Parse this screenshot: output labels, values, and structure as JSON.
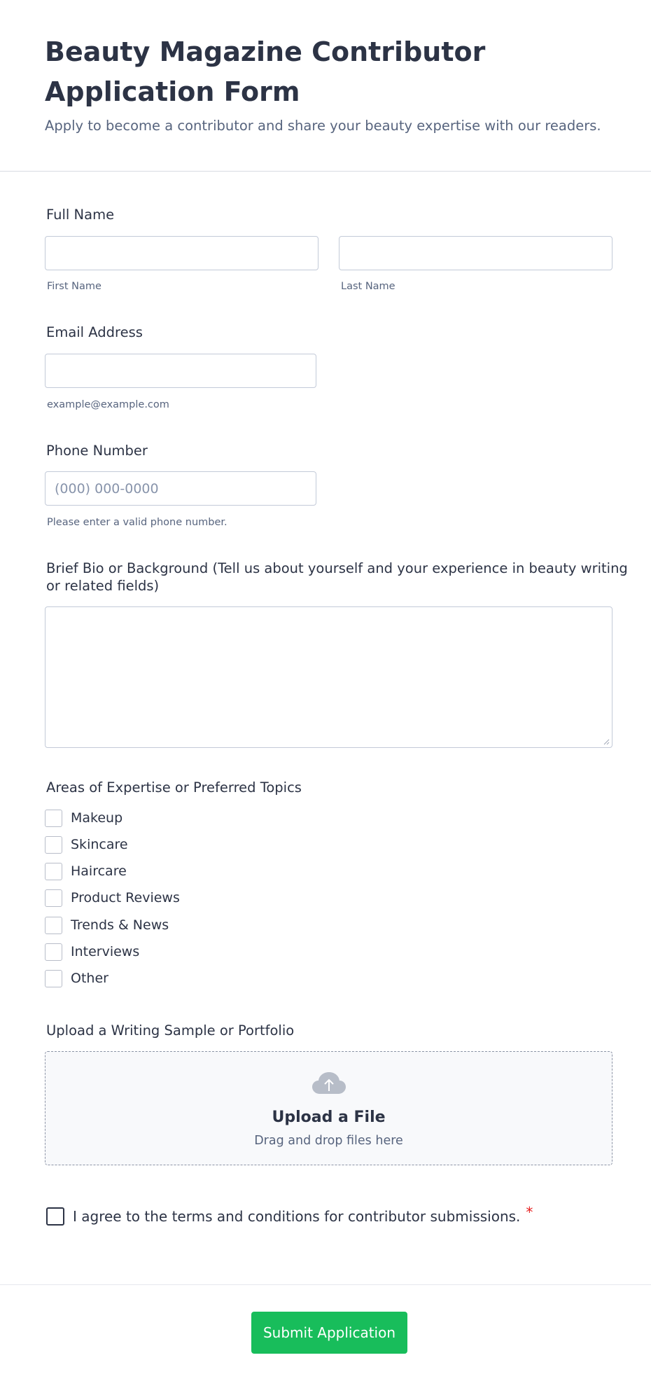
{
  "header": {
    "title": "Beauty Magazine Contributor Application Form",
    "subtitle": "Apply to become a contributor and share your beauty expertise with our readers."
  },
  "full_name": {
    "label": "Full Name",
    "first_sublabel": "First Name",
    "last_sublabel": "Last Name",
    "first_value": "",
    "last_value": ""
  },
  "email": {
    "label": "Email Address",
    "value": "",
    "sublabel": "example@example.com"
  },
  "phone": {
    "label": "Phone Number",
    "placeholder": "(000) 000-0000",
    "sublabel": "Please enter a valid phone number."
  },
  "bio": {
    "label_line1": "Brief Bio or Background (Tell us about yourself and your experience in beauty writing",
    "label_line2": "or related fields)",
    "value": ""
  },
  "expertise": {
    "label": "Areas of Expertise or Preferred Topics",
    "options": [
      "Makeup",
      "Skincare",
      "Haircare",
      "Product Reviews",
      "Trends & News",
      "Interviews",
      "Other"
    ]
  },
  "upload": {
    "label": "Upload a Writing Sample or Portfolio",
    "title": "Upload a File",
    "subtitle": "Drag and drop files here"
  },
  "terms": {
    "label": "I agree to the terms and conditions for contributor submissions.",
    "required_mark": "*"
  },
  "submit": {
    "label": "Submit Application"
  },
  "colors": {
    "submit_bg": "#18bd5b",
    "required": "#e61e1e",
    "text": "#2c3345",
    "muted": "#57647e"
  }
}
